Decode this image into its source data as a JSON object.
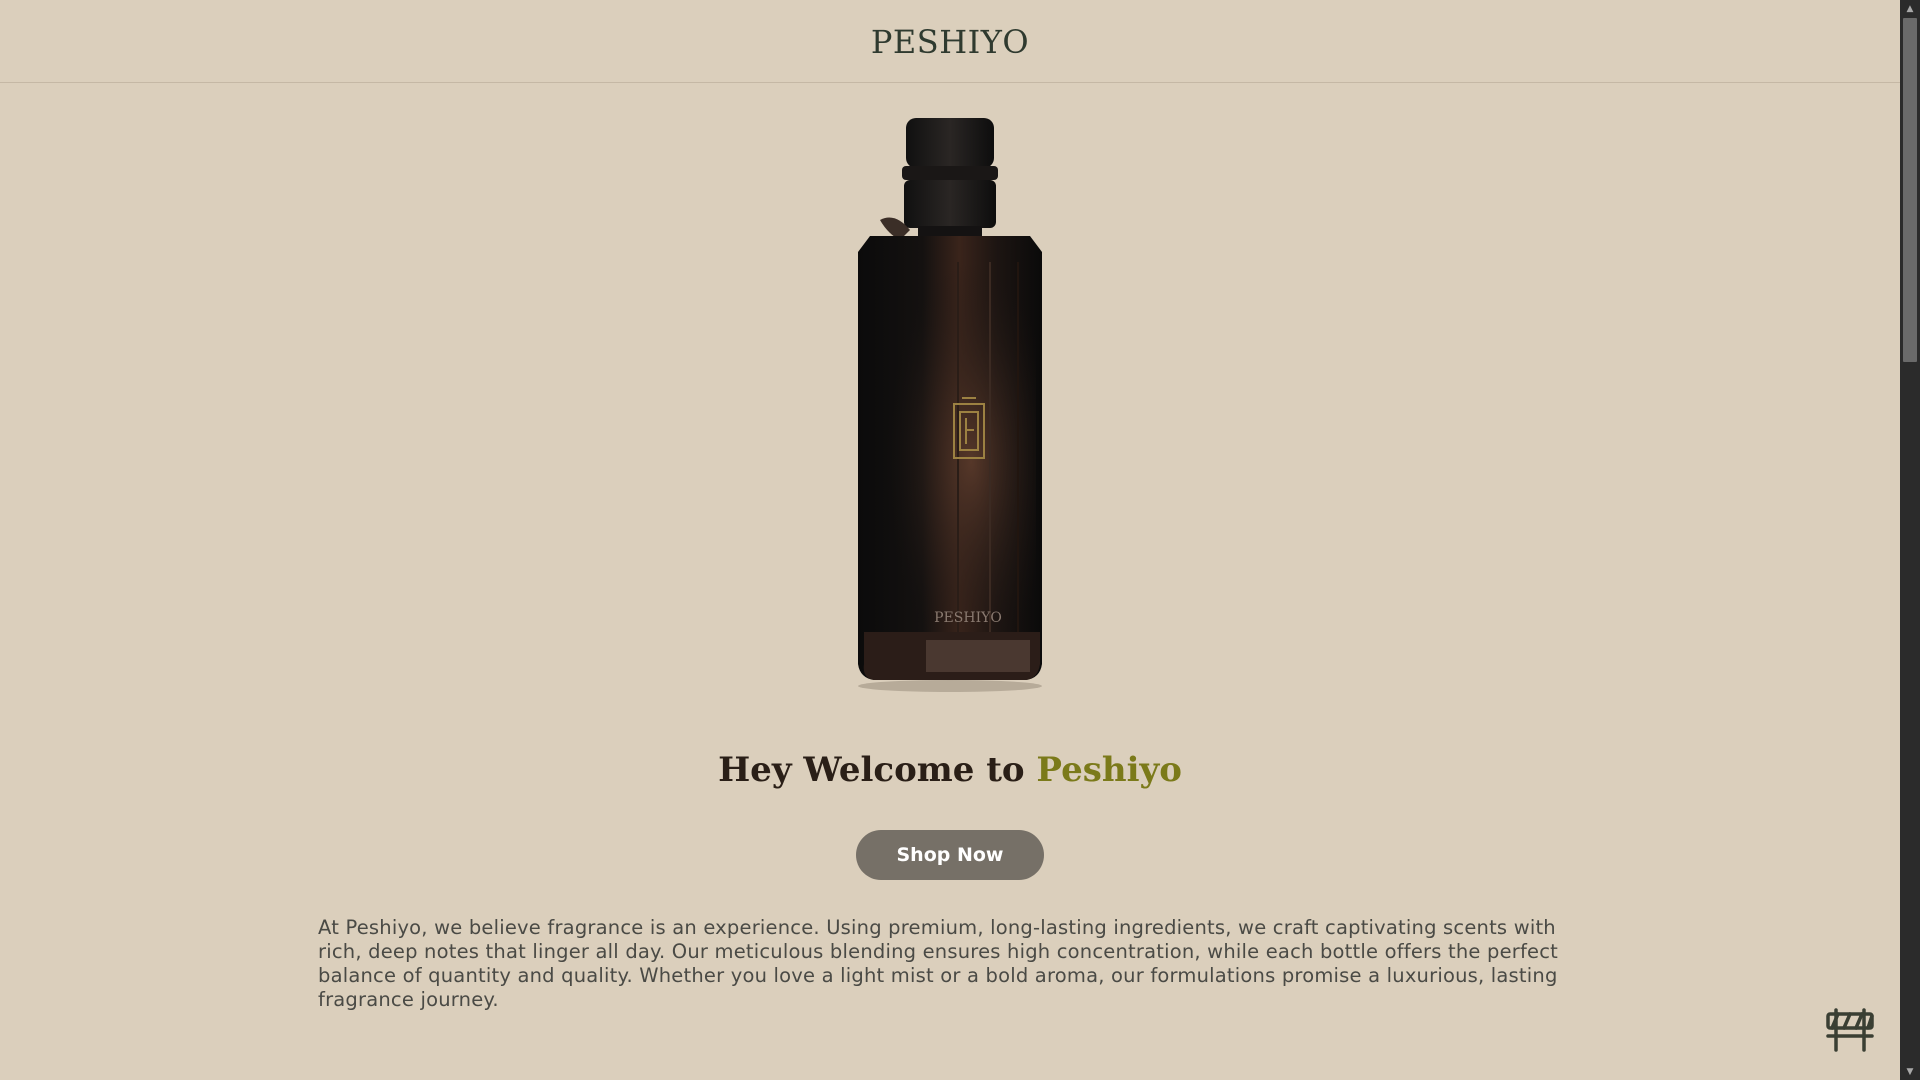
{
  "header": {
    "brand": "PESHIYO"
  },
  "hero": {
    "image_alt": "perfume-bottle",
    "bottle_label": "PESHIYO"
  },
  "welcome": {
    "prefix": "Hey Welcome to ",
    "brand_accent": "Peshiyo"
  },
  "cta": {
    "label": "Shop Now"
  },
  "about": {
    "text": "At Peshiyo, we believe fragrance is an experience. Using premium, long-lasting ingredients, we craft captivating scents with rich, deep notes that linger all day. Our meticulous blending ensures high concentration, while each bottle offers the perfect balance of quantity and quality. Whether you love a light mist or a bold aroma, our formulations promise a luxurious, lasting fragrance journey."
  },
  "colors": {
    "background": "#dbcfbc",
    "accent": "#7b7a1a",
    "button": "#767067"
  },
  "icons": {
    "floating": "construction-barrier-icon"
  }
}
